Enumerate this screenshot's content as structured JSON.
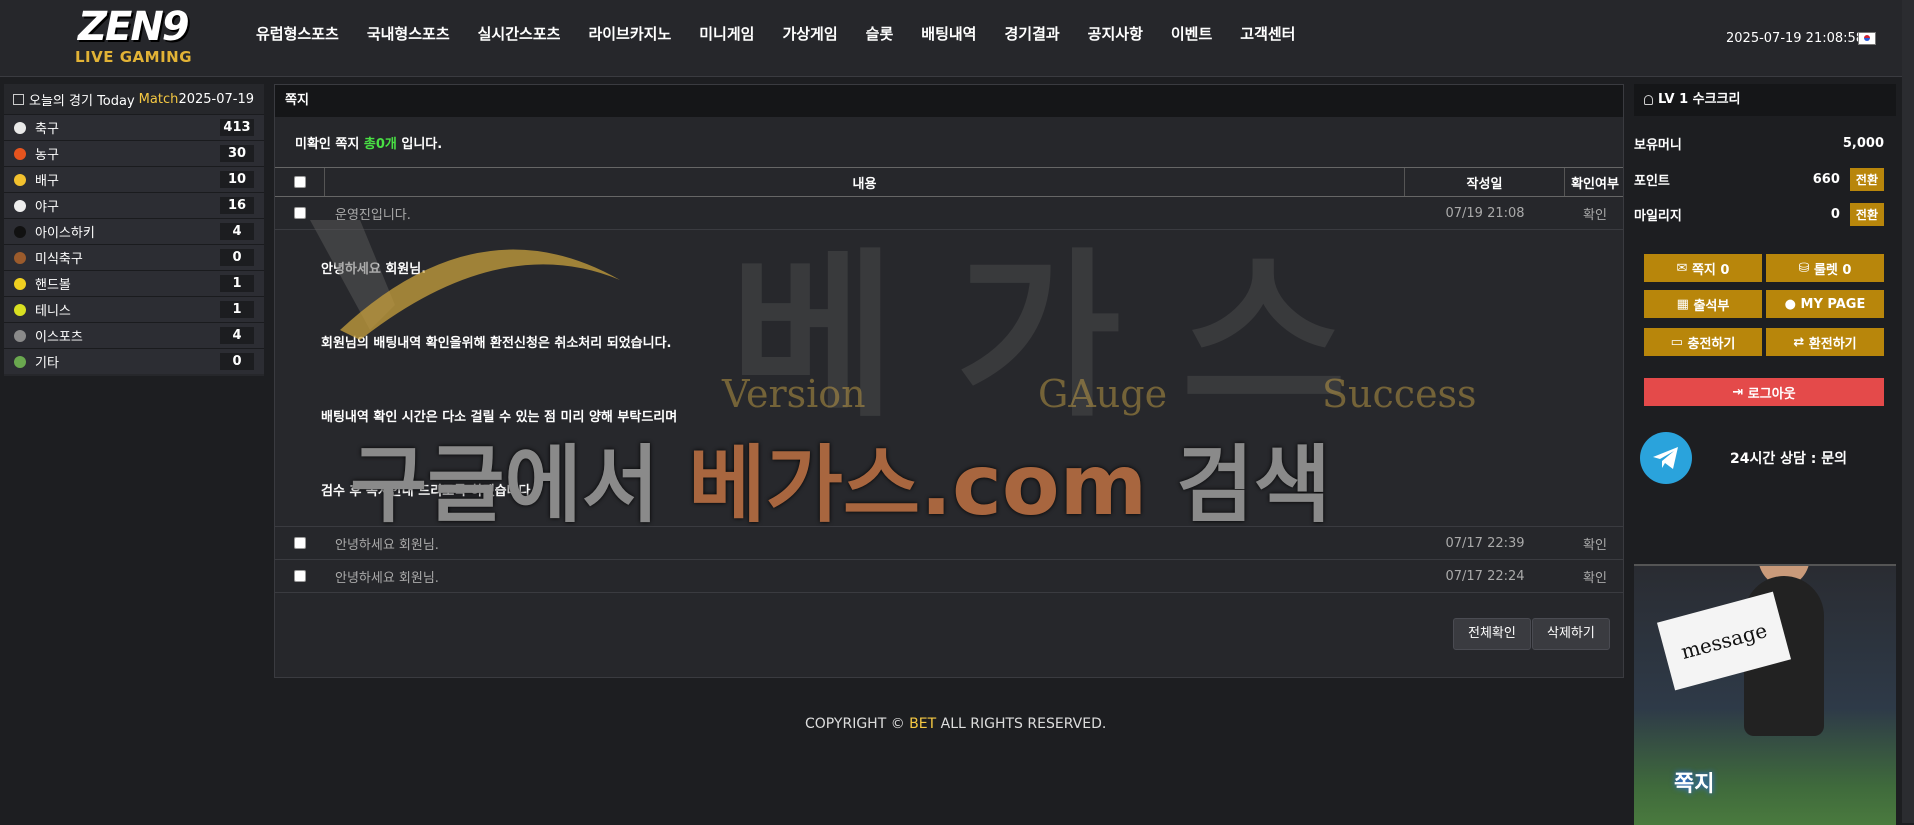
{
  "header": {
    "logo_main": "ZEN9",
    "logo_sub": "LIVE GAMING",
    "nav": [
      "유럽형스포츠",
      "국내형스포츠",
      "실시간스포츠",
      "라이브카지노",
      "미니게임",
      "가상게임",
      "슬롯",
      "배팅내역",
      "경기결과",
      "공지사항",
      "이벤트",
      "고객센터"
    ],
    "datetime": "2025-07-19 21:08:58"
  },
  "left_panel": {
    "title": "오늘의 경기 Today",
    "title_highlight": "Match",
    "date": "2025-07-19",
    "sports": [
      {
        "name": "축구",
        "count": "413",
        "color": "#e9e9e9"
      },
      {
        "name": "농구",
        "count": "30",
        "color": "#e6541e"
      },
      {
        "name": "배구",
        "count": "10",
        "color": "#f2c12e"
      },
      {
        "name": "야구",
        "count": "16",
        "color": "#eeeeee"
      },
      {
        "name": "아이스하키",
        "count": "4",
        "color": "#111111"
      },
      {
        "name": "미식축구",
        "count": "0",
        "color": "#9b5b2c"
      },
      {
        "name": "핸드볼",
        "count": "1",
        "color": "#f0d020"
      },
      {
        "name": "테니스",
        "count": "1",
        "color": "#d9e021"
      },
      {
        "name": "이스포츠",
        "count": "4",
        "color": "#8a8a8a"
      },
      {
        "name": "기타",
        "count": "0",
        "color": "#6aa84f"
      }
    ]
  },
  "main": {
    "title": "쪽지",
    "notice_pre": "미확인 쪽지",
    "notice_count": "총0개",
    "notice_post": "입니다.",
    "columns": {
      "content": "내용",
      "date": "작성일",
      "status": "확인여부"
    },
    "rows": [
      {
        "title": "운영진입니다.",
        "date": "07/19 21:08",
        "status": "확인"
      },
      {
        "title": "안녕하세요 회원님.",
        "date": "07/17 22:39",
        "status": "확인"
      },
      {
        "title": "안녕하세요 회원님.",
        "date": "07/17 22:24",
        "status": "확인"
      }
    ],
    "expanded_message": [
      "안녕하세요 회원님.",
      "회원님의 배팅내역 확인을위해 환전신청은 취소처리 되었습니다.",
      "배팅내역 확인 시간은 다소 걸릴 수 있는 점 미리 양해 부탁드리며",
      "검수 후 쪽지안내 드리도록 하겠습니다."
    ],
    "btn_read_all": "전체확인",
    "btn_delete": "삭제하기"
  },
  "watermark": {
    "big": "베가스",
    "words": [
      "Version",
      "GAuge",
      "Success"
    ],
    "line_pre": "구글에서",
    "line_mid": "베가스.com",
    "line_post": "검색"
  },
  "footer": {
    "pre": "COPYRIGHT ©",
    "brand": "BET",
    "post": "ALL RIGHTS RESERVED."
  },
  "right_panel": {
    "user": "LV 1 수크크리",
    "money_label": "보유머니",
    "money_value": "5,000",
    "point_label": "포인트",
    "point_value": "660",
    "mileage_label": "마일리지",
    "mileage_value": "0",
    "switch_label": "전환",
    "btn_note": "쪽지 0",
    "btn_roulette": "룰렛 0",
    "btn_attend": "출석부",
    "btn_mypage": "MY PAGE",
    "btn_charge": "충전하기",
    "btn_exchange": "환전하기",
    "btn_logout": "로그아웃",
    "telegram_label": "24시간 상담 : 문의",
    "promo_sign": "message",
    "promo_title": "쪽지"
  }
}
